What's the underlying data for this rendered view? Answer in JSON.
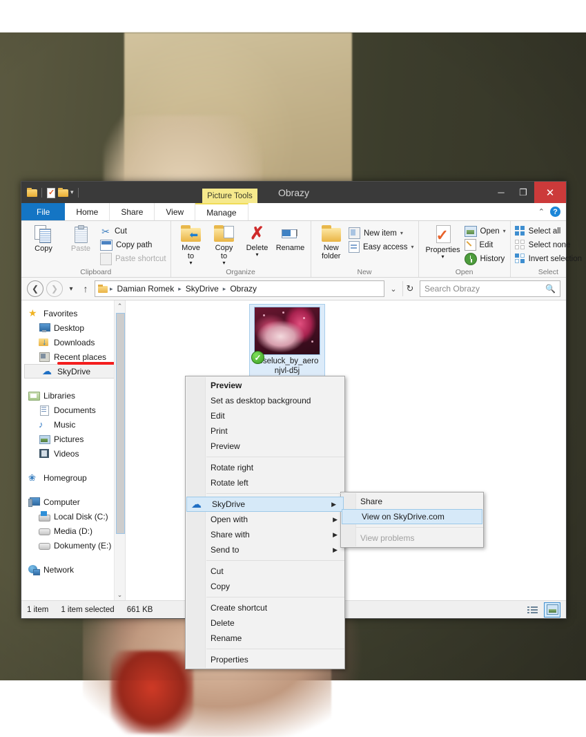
{
  "desktop": {
    "watermark": ""
  },
  "window": {
    "title": "Obrazy",
    "contextual_tab_group": "Picture Tools",
    "quick_access": [
      {
        "name": "folder-icon",
        "label": ""
      },
      {
        "name": "properties-icon",
        "label": ""
      },
      {
        "name": "new-folder-icon",
        "label": ""
      },
      {
        "name": "customize-caret-icon",
        "label": "▾"
      }
    ],
    "controls": {
      "minimize": "─",
      "maximize": "❐",
      "close": "✕"
    }
  },
  "tabs": [
    {
      "label": "File"
    },
    {
      "label": "Home"
    },
    {
      "label": "Share"
    },
    {
      "label": "View"
    },
    {
      "label": "Manage"
    }
  ],
  "tabrow_right": {
    "collapse": "⌃",
    "help": "?"
  },
  "ribbon": {
    "groups": [
      {
        "label": "Clipboard",
        "big": [
          {
            "label": "Copy",
            "icon": "copy-icon",
            "disabled": false
          },
          {
            "label": "Paste",
            "icon": "paste-icon",
            "disabled": true
          }
        ],
        "small": [
          {
            "label": "Cut",
            "icon": "cut-icon",
            "disabled": false,
            "caret": ""
          },
          {
            "label": "Copy path",
            "icon": "copy-path-icon",
            "disabled": false,
            "caret": ""
          },
          {
            "label": "Paste shortcut",
            "icon": "paste-shortcut-icon",
            "disabled": true,
            "caret": ""
          }
        ]
      },
      {
        "label": "Organize",
        "big": [
          {
            "label": "Move\nto",
            "icon": "move-to-icon",
            "caret": "▾"
          },
          {
            "label": "Copy\nto",
            "icon": "copy-to-icon",
            "caret": "▾"
          },
          {
            "label": "Delete",
            "icon": "delete-icon",
            "caret": "▾"
          },
          {
            "label": "Rename",
            "icon": "rename-icon",
            "caret": ""
          }
        ],
        "small": []
      },
      {
        "label": "New",
        "big": [
          {
            "label": "New\nfolder",
            "icon": "new-folder-icon",
            "caret": ""
          }
        ],
        "small": [
          {
            "label": "New item",
            "icon": "new-item-icon",
            "caret": "▾"
          },
          {
            "label": "Easy access",
            "icon": "easy-access-icon",
            "caret": "▾"
          }
        ]
      },
      {
        "label": "Open",
        "big": [
          {
            "label": "Properties",
            "icon": "properties-icon",
            "caret": "▾"
          }
        ],
        "small": [
          {
            "label": "Open",
            "icon": "open-icon",
            "caret": "▾"
          },
          {
            "label": "Edit",
            "icon": "edit-icon",
            "caret": ""
          },
          {
            "label": "History",
            "icon": "history-icon",
            "caret": ""
          }
        ]
      },
      {
        "label": "Select",
        "big": [],
        "small": [
          {
            "label": "Select all",
            "icon": "select-all-icon",
            "caret": ""
          },
          {
            "label": "Select none",
            "icon": "select-none-icon",
            "caret": ""
          },
          {
            "label": "Invert selection",
            "icon": "invert-selection-icon",
            "caret": ""
          }
        ]
      }
    ]
  },
  "address": {
    "back": "❮",
    "forward": "❯",
    "recent_caret": "▾",
    "up": "↑",
    "crumbs": [
      "Damian Romek",
      "SkyDrive",
      "Obrazy"
    ],
    "separator": "▸",
    "dropdown_caret": "⌄",
    "refresh": "↻"
  },
  "search": {
    "placeholder": "Search Obrazy",
    "icon": "search-icon"
  },
  "sidebar": {
    "sections": [
      {
        "header": {
          "label": "Favorites",
          "icon": "star-icon"
        },
        "items": [
          {
            "label": "Desktop",
            "icon": "desktop-icon",
            "selected": false
          },
          {
            "label": "Downloads",
            "icon": "downloads-icon",
            "selected": false
          },
          {
            "label": "Recent places",
            "icon": "recent-places-icon",
            "selected": false
          },
          {
            "label": "SkyDrive",
            "icon": "skydrive-icon",
            "selected": true
          }
        ]
      },
      {
        "header": {
          "label": "Libraries",
          "icon": "libraries-icon"
        },
        "items": [
          {
            "label": "Documents",
            "icon": "documents-icon",
            "selected": false
          },
          {
            "label": "Music",
            "icon": "music-icon",
            "selected": false
          },
          {
            "label": "Pictures",
            "icon": "pictures-icon",
            "selected": false
          },
          {
            "label": "Videos",
            "icon": "videos-icon",
            "selected": false
          }
        ]
      },
      {
        "header": {
          "label": "Homegroup",
          "icon": "homegroup-icon"
        },
        "items": []
      },
      {
        "header": {
          "label": "Computer",
          "icon": "computer-icon"
        },
        "items": [
          {
            "label": "Local Disk (C:)",
            "icon": "local-disk-icon",
            "selected": false
          },
          {
            "label": "Media (D:)",
            "icon": "drive-icon",
            "selected": false
          },
          {
            "label": "Dokumenty (E:)",
            "icon": "drive-icon",
            "selected": false
          }
        ]
      },
      {
        "header": {
          "label": "Network",
          "icon": "network-icon"
        },
        "items": []
      }
    ],
    "scroll": {
      "up": "⌃",
      "down": "⌄"
    }
  },
  "files": [
    {
      "name": "roseluck_by_aero\nnjvl-d5j",
      "selected": true,
      "sync_badge": "✓"
    }
  ],
  "status": {
    "count": "1 item",
    "selection": "1 item selected",
    "size": "661 KB",
    "views": [
      {
        "name": "details-view-button",
        "active": false
      },
      {
        "name": "large-icons-view-button",
        "active": true
      }
    ]
  },
  "context_menu": {
    "items": [
      {
        "label": "Preview",
        "bold": true,
        "disabled": false,
        "submenu": false,
        "icon": ""
      },
      {
        "label": "Set as desktop background",
        "bold": false,
        "disabled": false,
        "submenu": false,
        "icon": ""
      },
      {
        "label": "Edit",
        "bold": false,
        "disabled": false,
        "submenu": false,
        "icon": ""
      },
      {
        "label": "Print",
        "bold": false,
        "disabled": false,
        "submenu": false,
        "icon": ""
      },
      {
        "label": "Preview",
        "bold": false,
        "disabled": false,
        "submenu": false,
        "icon": ""
      },
      {
        "separator": true
      },
      {
        "label": "Rotate right",
        "bold": false,
        "disabled": false,
        "submenu": false,
        "icon": ""
      },
      {
        "label": "Rotate left",
        "bold": false,
        "disabled": false,
        "submenu": false,
        "icon": ""
      },
      {
        "separator": true
      },
      {
        "label": "SkyDrive",
        "bold": false,
        "disabled": false,
        "submenu": true,
        "icon": "skydrive-cloud-icon",
        "highlighted": true
      },
      {
        "label": "Open with",
        "bold": false,
        "disabled": false,
        "submenu": true,
        "icon": ""
      },
      {
        "label": "Share with",
        "bold": false,
        "disabled": false,
        "submenu": true,
        "icon": ""
      },
      {
        "label": "Send to",
        "bold": false,
        "disabled": false,
        "submenu": true,
        "icon": ""
      },
      {
        "separator": true
      },
      {
        "label": "Cut",
        "bold": false,
        "disabled": false,
        "submenu": false,
        "icon": ""
      },
      {
        "label": "Copy",
        "bold": false,
        "disabled": false,
        "submenu": false,
        "icon": ""
      },
      {
        "separator": true
      },
      {
        "label": "Create shortcut",
        "bold": false,
        "disabled": false,
        "submenu": false,
        "icon": ""
      },
      {
        "label": "Delete",
        "bold": false,
        "disabled": false,
        "submenu": false,
        "icon": ""
      },
      {
        "label": "Rename",
        "bold": false,
        "disabled": false,
        "submenu": false,
        "icon": ""
      },
      {
        "separator": true
      },
      {
        "label": "Properties",
        "bold": false,
        "disabled": false,
        "submenu": false,
        "icon": ""
      }
    ],
    "submenu_arrow": "▶"
  },
  "submenu": {
    "items": [
      {
        "label": "Share",
        "disabled": false,
        "highlighted": false
      },
      {
        "label": "View on SkyDrive.com",
        "disabled": false,
        "highlighted": true
      },
      {
        "separator": true
      },
      {
        "label": "View problems",
        "disabled": true,
        "highlighted": false
      }
    ]
  },
  "annotation": {
    "type": "red-underline",
    "target": "SkyDrive",
    "color": "#f41e1e"
  },
  "colors": {
    "accent_blue": "#1475c4",
    "titlebar": "#3a3a3a",
    "close_red": "#cc3a3a",
    "contextual_yellow": "#f6e98c",
    "selection_blue": "#d6e9f8",
    "annotation_red": "#f41e1e"
  }
}
